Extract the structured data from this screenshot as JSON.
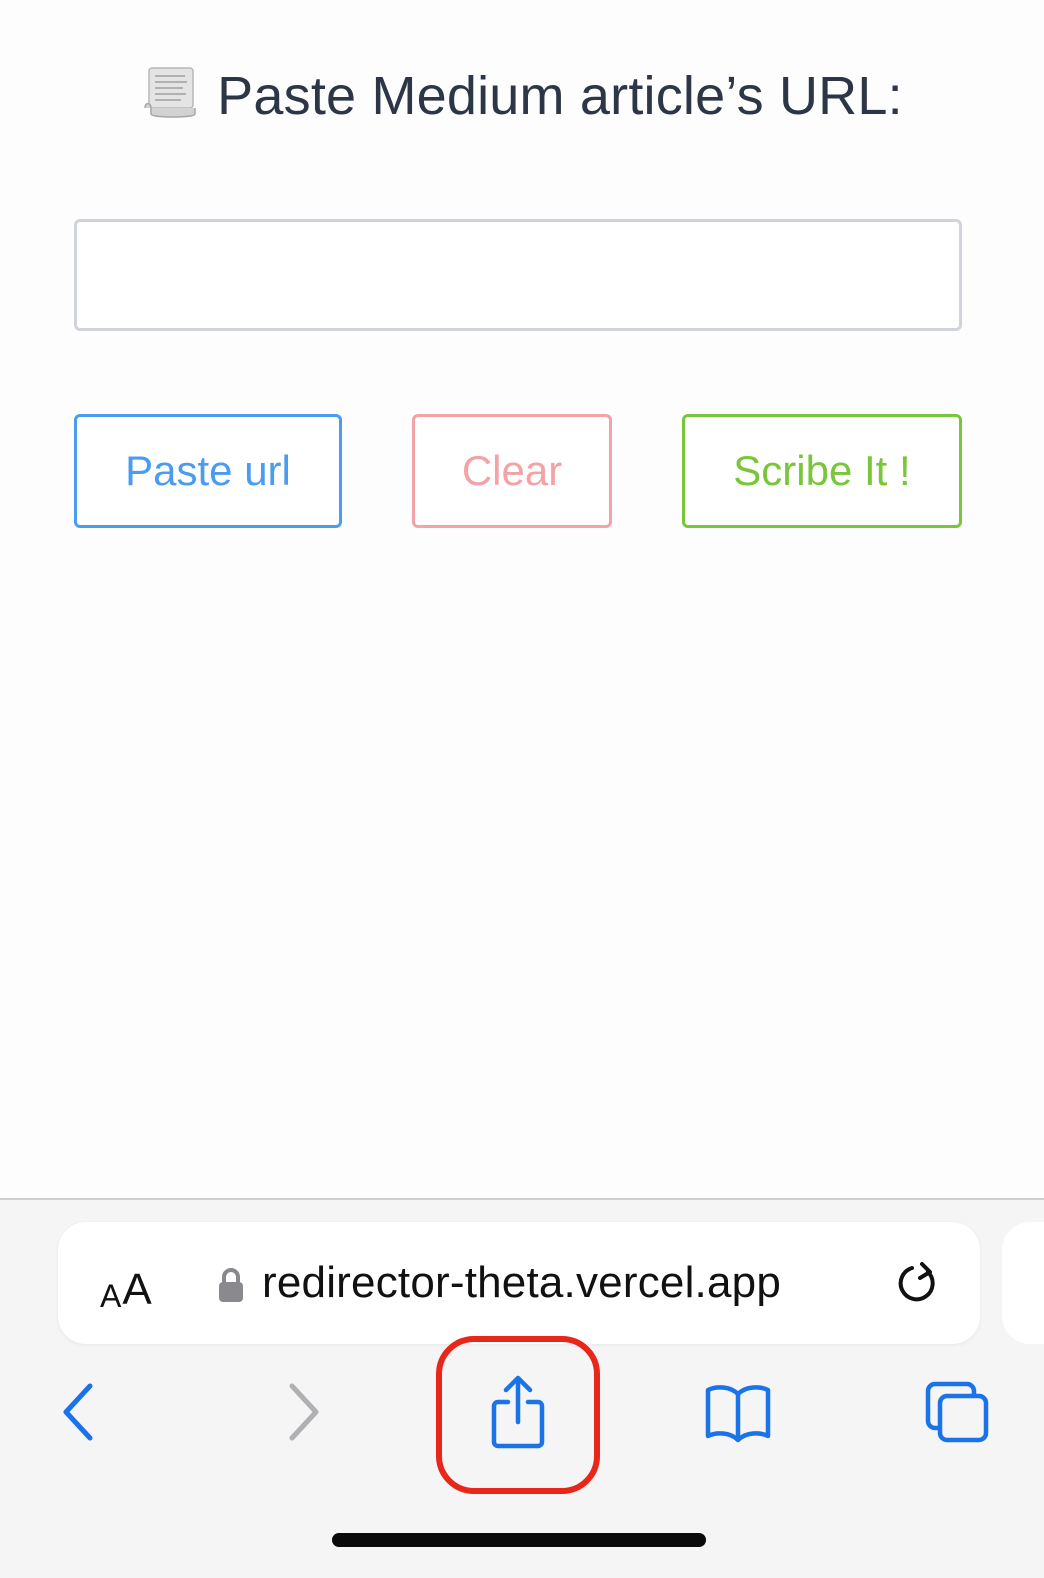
{
  "page": {
    "heading": "Paste Medium article’s URL:",
    "url_input": {
      "value": "",
      "placeholder": ""
    },
    "buttons": {
      "paste_label": "Paste url",
      "clear_label": "Clear",
      "scribe_label": "Scribe It !"
    }
  },
  "browser": {
    "aa_small": "A",
    "aa_big": "A",
    "url": "redirector-theta.vercel.app"
  },
  "icons": {
    "heading": "scroll-icon",
    "address_bar": [
      "lock-icon",
      "reload-icon"
    ],
    "toolbar": [
      "back-icon",
      "forward-icon",
      "share-icon",
      "bookmarks-icon",
      "tabs-icon"
    ]
  },
  "colors": {
    "paste": "#4b9cf0",
    "clear": "#f3a3a6",
    "scribe": "#7ac63a",
    "ios_blue": "#1a73e8",
    "highlight": "#e9261a"
  }
}
